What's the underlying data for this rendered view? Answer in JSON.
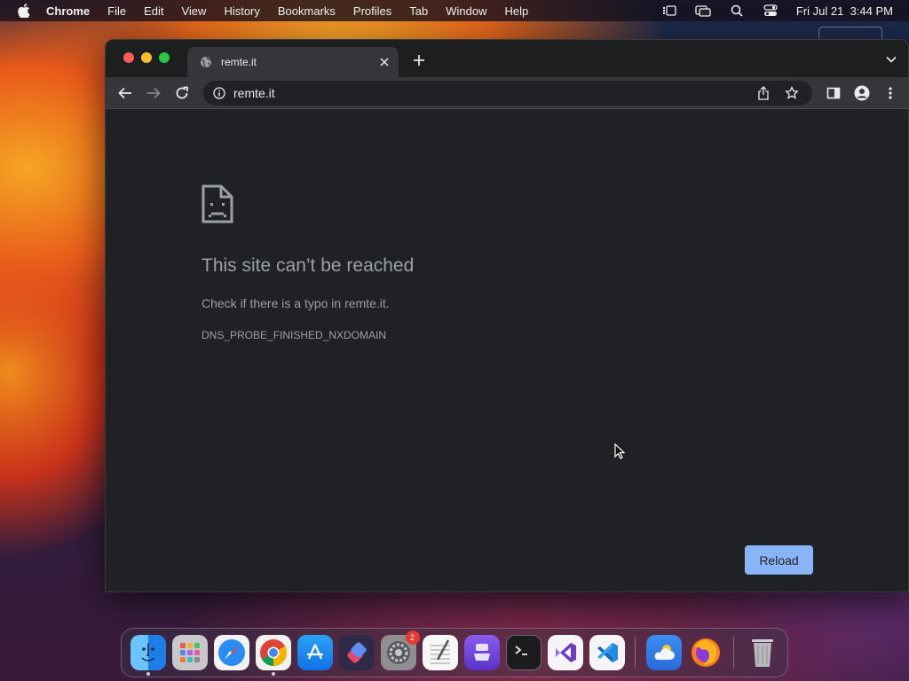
{
  "menubar": {
    "app_name": "Chrome",
    "items": [
      "File",
      "Edit",
      "View",
      "History",
      "Bookmarks",
      "Profiles",
      "Tab",
      "Window",
      "Help"
    ],
    "clock": "Fri Jul 21  3:44 PM"
  },
  "tab": {
    "title": "remte.it"
  },
  "toolbar": {
    "url": "remte.it"
  },
  "error": {
    "title": "This site can’t be reached",
    "description": "Check if there is a typo in remte.it.",
    "code": "DNS_PROBE_FINISHED_NXDOMAIN",
    "reload_label": "Reload"
  },
  "dock": {
    "apps": [
      "Finder",
      "Launchpad",
      "Safari",
      "Google Chrome",
      "App Store",
      "Shortcuts",
      "System Settings",
      "TextEdit",
      "Simulator",
      "Terminal",
      "Visual Studio",
      "Visual Studio Code",
      "Weather",
      "Firefox",
      "Trash"
    ],
    "settings_badge": "2"
  },
  "colors": {
    "reload_button": "#8ab4f8",
    "page_background": "#202124",
    "error_text": "#9aa0a6"
  }
}
